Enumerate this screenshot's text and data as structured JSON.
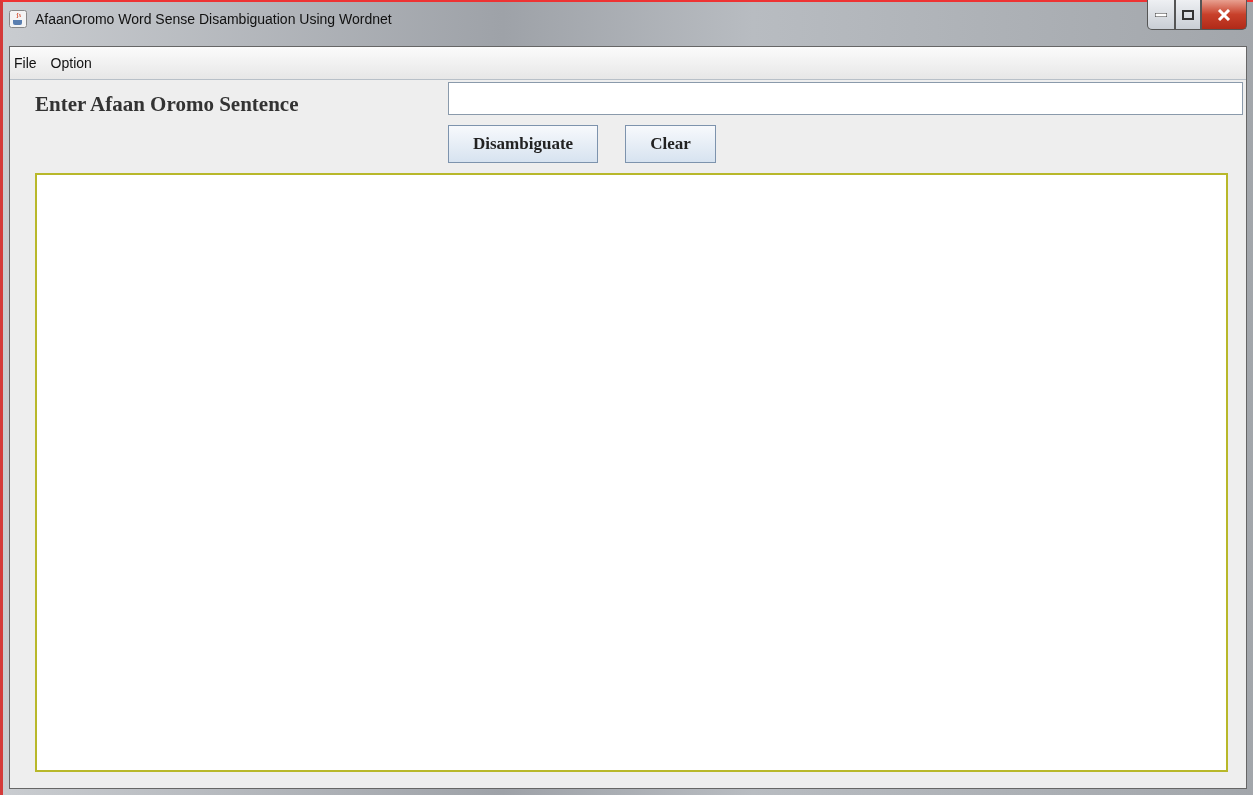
{
  "window": {
    "title": "AfaanOromo Word Sense Disambiguation Using Wordnet"
  },
  "menu": [
    "File",
    "Option"
  ],
  "form": {
    "label": "Enter Afaan Oromo Sentence",
    "buttons": [
      "Disambiguate",
      "Clear"
    ]
  }
}
